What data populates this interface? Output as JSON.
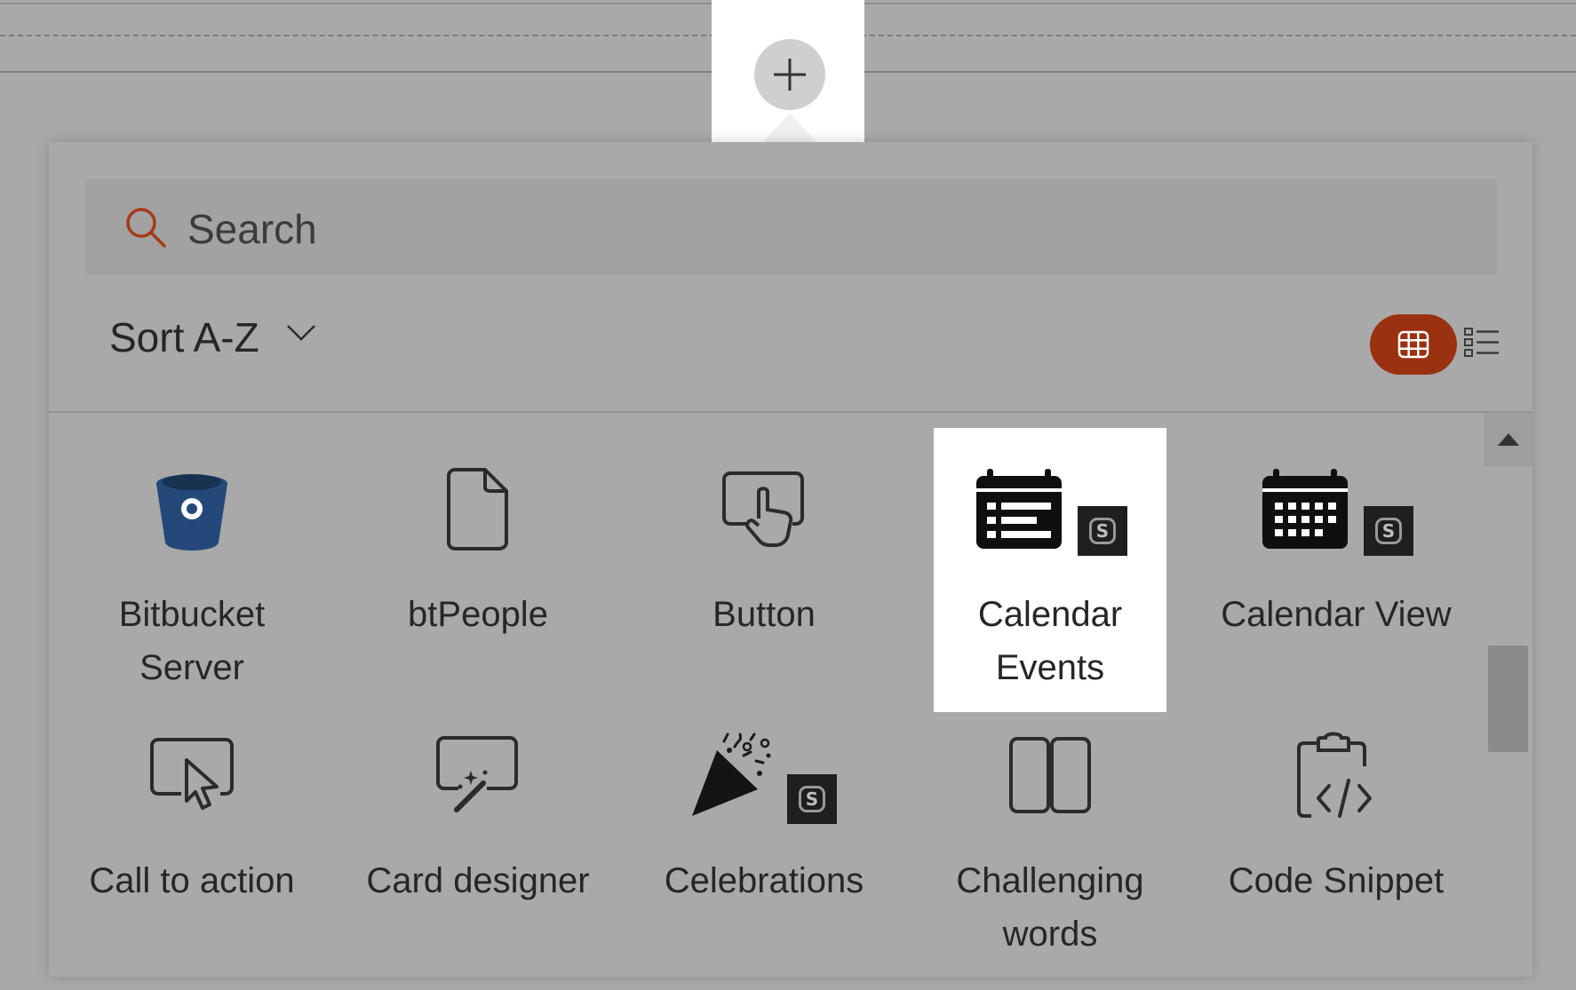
{
  "search": {
    "placeholder": "Search",
    "value": ""
  },
  "sort": {
    "label": "Sort A-Z"
  },
  "view_toggle": {
    "active": "grid",
    "accent": "#9a3110"
  },
  "colors": {
    "bitbucket": "#23497a",
    "search_icon": "#a53a17",
    "badge": "#1f1f1f"
  },
  "tiles": [
    {
      "label": "Bitbucket Server",
      "icon": "bitbucket-icon",
      "badge": false,
      "selected": false
    },
    {
      "label": "btPeople",
      "icon": "document-icon",
      "badge": false,
      "selected": false
    },
    {
      "label": "Button",
      "icon": "touch-button-icon",
      "badge": false,
      "selected": false
    },
    {
      "label": "Calendar Events",
      "icon": "calendar-events-icon",
      "badge": true,
      "selected": true
    },
    {
      "label": "Calendar View",
      "icon": "calendar-view-icon",
      "badge": true,
      "selected": false
    },
    {
      "label": "Call to action",
      "icon": "call-to-action-icon",
      "badge": false,
      "selected": false
    },
    {
      "label": "Card designer",
      "icon": "card-designer-icon",
      "badge": false,
      "selected": false
    },
    {
      "label": "Celebrations",
      "icon": "celebrations-icon",
      "badge": true,
      "selected": false
    },
    {
      "label": "Challenging words",
      "icon": "book-icon",
      "badge": false,
      "selected": false
    },
    {
      "label": "Code Snippet",
      "icon": "code-snippet-icon",
      "badge": false,
      "selected": false
    }
  ],
  "badge_glyph": "S"
}
